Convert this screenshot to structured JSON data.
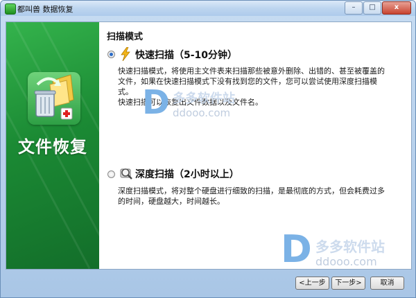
{
  "window": {
    "title": "都叫兽 数据恢复",
    "controls": {
      "minimize": "–",
      "maximize": "□",
      "close": "x"
    }
  },
  "sidebar": {
    "title": "文件恢复"
  },
  "content": {
    "section_title": "扫描模式",
    "options": [
      {
        "label": "快速扫描（5-10分钟）",
        "checked": true,
        "icon": "lightning-icon",
        "description_lines": [
          "快速扫描模式，将使用主文件表来扫描那些被意外删除、出错的、甚至被覆盖的",
          "文件，如果在快速扫描模式下没有找到您的文件，您可以尝试使用深度扫描模",
          "式。",
          "快速扫描可以恢复出文件数据以及文件名。"
        ]
      },
      {
        "label": "深度扫描（2小时以上）",
        "checked": false,
        "icon": "magnifier-disk-icon",
        "description_lines": [
          "深度扫描模式，将对整个硬盘进行细致的扫描，是最彻底的方式，但会耗费过多",
          "的时间，硬盘越大，时间越长。"
        ]
      }
    ]
  },
  "buttons": {
    "back": "<上一步",
    "next": "下一步>",
    "cancel": "取消"
  },
  "watermarks": [
    {
      "cn": "多多软件站",
      "en": "ddooo.com"
    },
    {
      "cn": "多多软件站",
      "en": "ddooo.com"
    }
  ],
  "colors": {
    "sidebar_green": "#1b8a34",
    "radio_dot": "#2a6bc7",
    "watermark_blue": "#7bb2e6"
  }
}
